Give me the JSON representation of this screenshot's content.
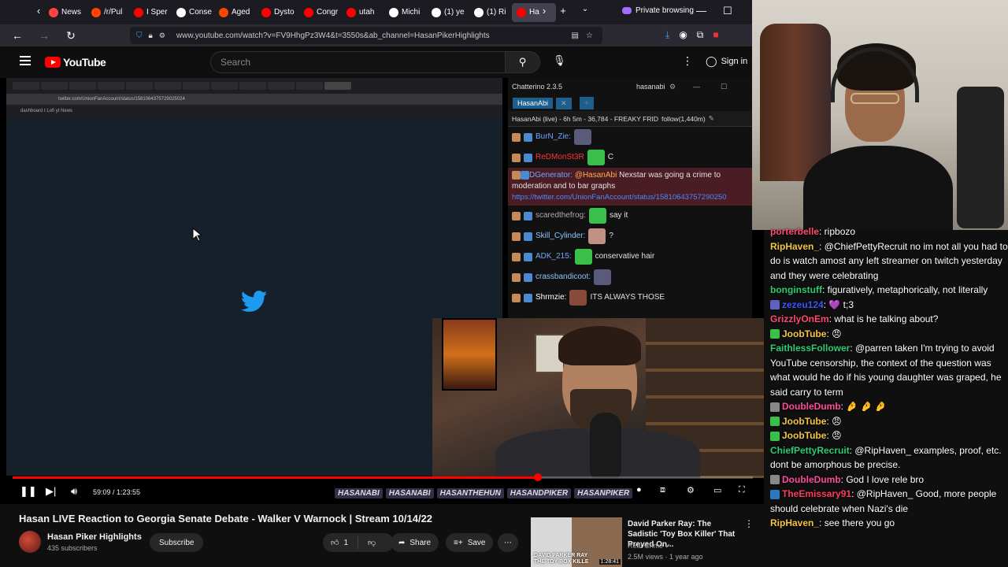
{
  "browser": {
    "tabs": [
      {
        "label": "News",
        "color": "#ff4444"
      },
      {
        "label": "/r/Pul",
        "color": "#ff4500"
      },
      {
        "label": "I Sper",
        "color": "#ff0000"
      },
      {
        "label": "Conse",
        "color": "#ffffff"
      },
      {
        "label": "Aged",
        "color": "#ff4500"
      },
      {
        "label": "Dysto",
        "color": "#ff0000"
      },
      {
        "label": "Congr",
        "color": "#ff0000"
      },
      {
        "label": "utah",
        "color": "#ff0000"
      },
      {
        "label": "Michi",
        "color": "#ffffff"
      },
      {
        "label": "(1) ye",
        "color": "#ffffff"
      },
      {
        "label": "(1) Ri",
        "color": "#ffffff"
      },
      {
        "label": "Ha",
        "color": "#ff0000"
      }
    ],
    "private_label": "Private browsing",
    "url": "www.youtube.com/watch?v=FV9HhgPz3W4&t=3550s&ab_channel=HasanPikerHighlights"
  },
  "youtube": {
    "logo_text": "YouTube",
    "search_placeholder": "Search",
    "signin_label": "Sign in"
  },
  "screen": {
    "inner_url": "twitter.com/UnionFanAccount/status/1581064375729025024",
    "bookmarks": "dashboard   t   Lofi   yt   News"
  },
  "chatterino": {
    "title": "Chatterino 2.3.5",
    "user": "hasanabi",
    "tab": "HasanAbi",
    "stream_info": "HasanAbi (live) - 6h 5m - 36,784 - FREAKY FRID",
    "follow": "follow(1,440m)",
    "messages": [
      {
        "user": "BurN_Zie:",
        "text": "",
        "color": "#6fa8ff"
      },
      {
        "user": "ReDMonSt3R",
        "text": "C",
        "color": "#ff3333"
      },
      {
        "user": "DGenerator:",
        "mention": "@HasanAbi",
        "text": "Nexstar was going a crime to moderation and to bar graphs",
        "link": "https://twitter.com/UnionFanAccount/status/15810643757290250",
        "color": "#6fa8ff"
      },
      {
        "user": "scaredthefrog:",
        "text": "say it",
        "color": "#aaaaaa"
      },
      {
        "user": "Skill_Cylinder:",
        "text": "?",
        "color": "#8fc3ff"
      },
      {
        "user": "ADK_215:",
        "text": "conservative hair",
        "color": "#6fa8ff"
      },
      {
        "user": "crassbandicoot:",
        "text": "",
        "color": "#8fc3ff"
      },
      {
        "user": "Shrmzie:",
        "text": "ITS ALWAYS THOSE",
        "color": "#ffffff"
      }
    ]
  },
  "player": {
    "progress": 0.71,
    "time": "59:09 / 1:23:55",
    "overlay": [
      "HASANABI",
      "HASANABI",
      "HASANTHEHUN",
      "HASANDPIKER",
      "HASANPIKER"
    ]
  },
  "video": {
    "title": "Hasan LIVE Reaction to Georgia Senate Debate - Walker V Warnock | Stream 10/14/22",
    "channel": "Hasan Piker Highlights",
    "subscribers": "435 subscribers",
    "subscribe_label": "Subscribe",
    "likes": "1",
    "share_label": "Share",
    "save_label": "Save"
  },
  "recommended": {
    "title": "David Parker Ray: The Sadistic 'Toy Box Killer' That Preyed On...",
    "channel": "Real Crime",
    "meta": "2.5M views · 1 year ago",
    "thumb_caption": "DAVID PARKER RAY\nTHE TOY-BOX KILLE",
    "duration": "1:28:41"
  },
  "chat": [
    {
      "user": "porterbelle",
      "text": ": ripbozo",
      "color": "#ff4a6e",
      "icon": ""
    },
    {
      "user": "RipHaven_",
      "text": ": @ChiefPettyRecruit no im not all you had to do is watch amost any left streamer on twitch yesterday and they were celebrating",
      "color": "#f5c542",
      "icon": ""
    },
    {
      "user": "bonginstuff",
      "text": ": figuratively, metaphorically, not literally",
      "color": "#2ecc71",
      "icon": ""
    },
    {
      "user": "zezeu124",
      "text": ": 💜 t;3",
      "color": "#3a56ff",
      "icon": "#6060c0"
    },
    {
      "user": "GrizzlyOnEm",
      "text": ": what is he talking about?",
      "color": "#ff4a6e",
      "icon": ""
    },
    {
      "user": "JoobTube",
      "text": ": 😠",
      "color": "#f5c542",
      "icon": "#3ac04a"
    },
    {
      "user": "FaithlessFollower",
      "text": ": @parren taken I'm trying to avoid YouTube censorship, the context of the question was what would he do if his young daughter was graped, he said carry to term",
      "color": "#2ecc71",
      "icon": ""
    },
    {
      "user": "DoubleDumb",
      "text": ": 🤌 🤌 🤌",
      "color": "#ff4a9e",
      "icon": "#888888"
    },
    {
      "user": "JoobTube",
      "text": ": 😠",
      "color": "#f5c542",
      "icon": "#3ac04a"
    },
    {
      "user": "JoobTube",
      "text": ": 😠",
      "color": "#f5c542",
      "icon": "#3ac04a"
    },
    {
      "user": "ChiefPettyRecruit",
      "text": ": @RipHaven_ examples, proof, etc. dont be amorphous be precise.",
      "color": "#2ecc71",
      "icon": ""
    },
    {
      "user": "DoubleDumb",
      "text": ": God I love rele bro",
      "color": "#ff4a9e",
      "icon": "#888888"
    },
    {
      "user": "TheEmissary91",
      "text": ": @RipHaven_ Good, more people should celebrate when Nazi's die",
      "color": "#ff3a5e",
      "icon": "#2a7ac0"
    },
    {
      "user": "RipHaven_",
      "text": ": see there you go",
      "color": "#f5c542",
      "icon": ""
    }
  ]
}
